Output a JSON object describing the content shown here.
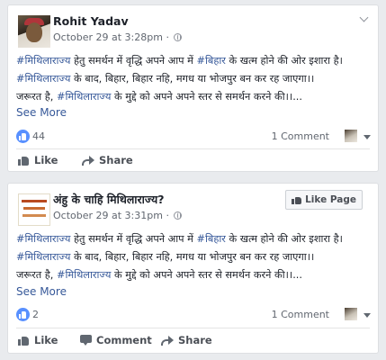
{
  "posts": [
    {
      "author": "Rohit Yadav",
      "timestamp": "October 29 at 3:28pm",
      "privacy_icon": "globe-icon",
      "lines": [
        [
          {
            "t": "#मिथिलाराज्य",
            "tag": true
          },
          {
            "t": " हेतु समर्थन में वृद्धि अपने आप में ",
            "tag": false
          },
          {
            "t": "#बिहार",
            "tag": true
          },
          {
            "t": " के खत्म होने की ओर इशारा है।",
            "tag": false
          }
        ],
        [
          {
            "t": "#मिथिलाराज्य",
            "tag": true
          },
          {
            "t": " के बाद, बिहार, बिहार नहि, मगध या भोजपुर बन कर रह जाएगा।।",
            "tag": false
          }
        ],
        [
          {
            "t": "जरूरत है, ",
            "tag": false
          },
          {
            "t": "#मिथिलाराज्य",
            "tag": true
          },
          {
            "t": " के मुद्दे को अपने अपने स्तर से समर्थन करने की।।...",
            "tag": false
          }
        ]
      ],
      "see_more": "See More",
      "like_count": "44",
      "comment_count": "1 Comment",
      "actions": {
        "like": "Like",
        "share": "Share"
      }
    },
    {
      "author": "अंहु के चाहि मिथिलाराज्य?",
      "timestamp": "October 29 at 3:31pm",
      "privacy_icon": "globe-icon",
      "like_page_label": "Like Page",
      "lines": [
        [
          {
            "t": "#मिथिलाराज्य",
            "tag": true
          },
          {
            "t": " हेतु समर्थन में वृद्धि अपने आप में ",
            "tag": false
          },
          {
            "t": "#बिहार",
            "tag": true
          },
          {
            "t": " के खत्म होने की ओर इशारा है।",
            "tag": false
          }
        ],
        [
          {
            "t": "#मिथिलाराज्य",
            "tag": true
          },
          {
            "t": " के बाद, बिहार, बिहार नहि, मगध या भोजपुर बन कर रह जाएगा।।",
            "tag": false
          }
        ],
        [
          {
            "t": "जरूरत है, ",
            "tag": false
          },
          {
            "t": "#मिथिलाराज्य",
            "tag": true
          },
          {
            "t": " के मुद्दे को अपने अपने स्तर से समर्थन करने की।।...",
            "tag": false
          }
        ]
      ],
      "see_more": "See More",
      "like_count": "2",
      "comment_count": "1 Comment",
      "actions": {
        "like": "Like",
        "comment": "Comment",
        "share": "Share"
      }
    }
  ],
  "colors": {
    "link": "#365899",
    "like_blue": "#5890ff",
    "text": "#1d2129",
    "meta": "#616770"
  }
}
